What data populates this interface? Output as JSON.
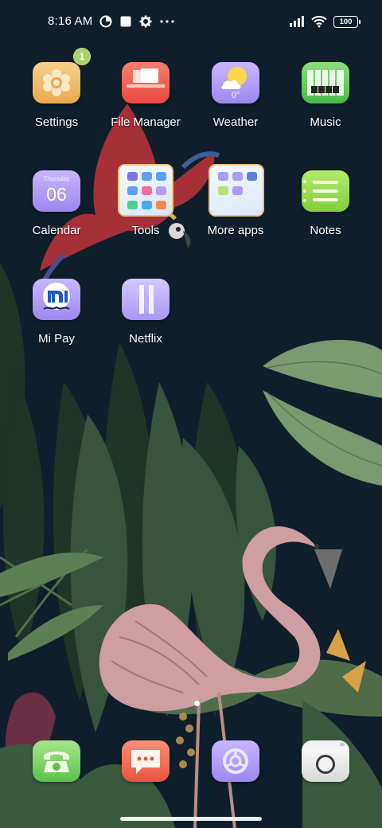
{
  "status_bar": {
    "time": "8:16 AM",
    "battery_level": "100",
    "icons_left": [
      "data-saver-icon",
      "square-notification-icon",
      "gear-icon",
      "more-dots-icon"
    ],
    "icons_right": [
      "signal-icon",
      "wifi-icon",
      "battery-icon"
    ]
  },
  "apps": {
    "settings": {
      "label": "Settings",
      "badge": "1",
      "icon": "gear-icon"
    },
    "file_manager": {
      "label": "File Manager",
      "icon": "folder-stack-icon"
    },
    "weather": {
      "label": "Weather",
      "temperature": "0°",
      "icon": "sun-cloud-icon"
    },
    "music": {
      "label": "Music",
      "icon": "piano-keys-icon"
    },
    "calendar": {
      "label": "Calendar",
      "weekday": "Thursday",
      "day": "06",
      "icon": "calendar-icon"
    },
    "tools": {
      "label": "Tools",
      "icon": "folder-icon"
    },
    "more_apps": {
      "label": "More apps",
      "icon": "folder-icon"
    },
    "notes": {
      "label": "Notes",
      "icon": "notes-icon"
    },
    "mi_pay": {
      "label": "Mi Pay",
      "icon": "mi-pay-icon"
    },
    "netflix": {
      "label": "Netflix",
      "icon": "netflix-n-icon"
    }
  },
  "dock": [
    {
      "name": "phone",
      "icon": "phone-icon"
    },
    {
      "name": "messages",
      "icon": "message-bubble-icon"
    },
    {
      "name": "browser",
      "icon": "browser-icon"
    },
    {
      "name": "camera",
      "icon": "camera-icon"
    }
  ],
  "pages": {
    "current": 1,
    "total": 1
  },
  "colors": {
    "background": "#0e1f2b",
    "leaf_dark": "#2f4a3a",
    "leaf_light": "#6f8f64",
    "flamingo": "#d8a0a4",
    "parrot": "#a83036",
    "badge": "#a7d36b"
  }
}
